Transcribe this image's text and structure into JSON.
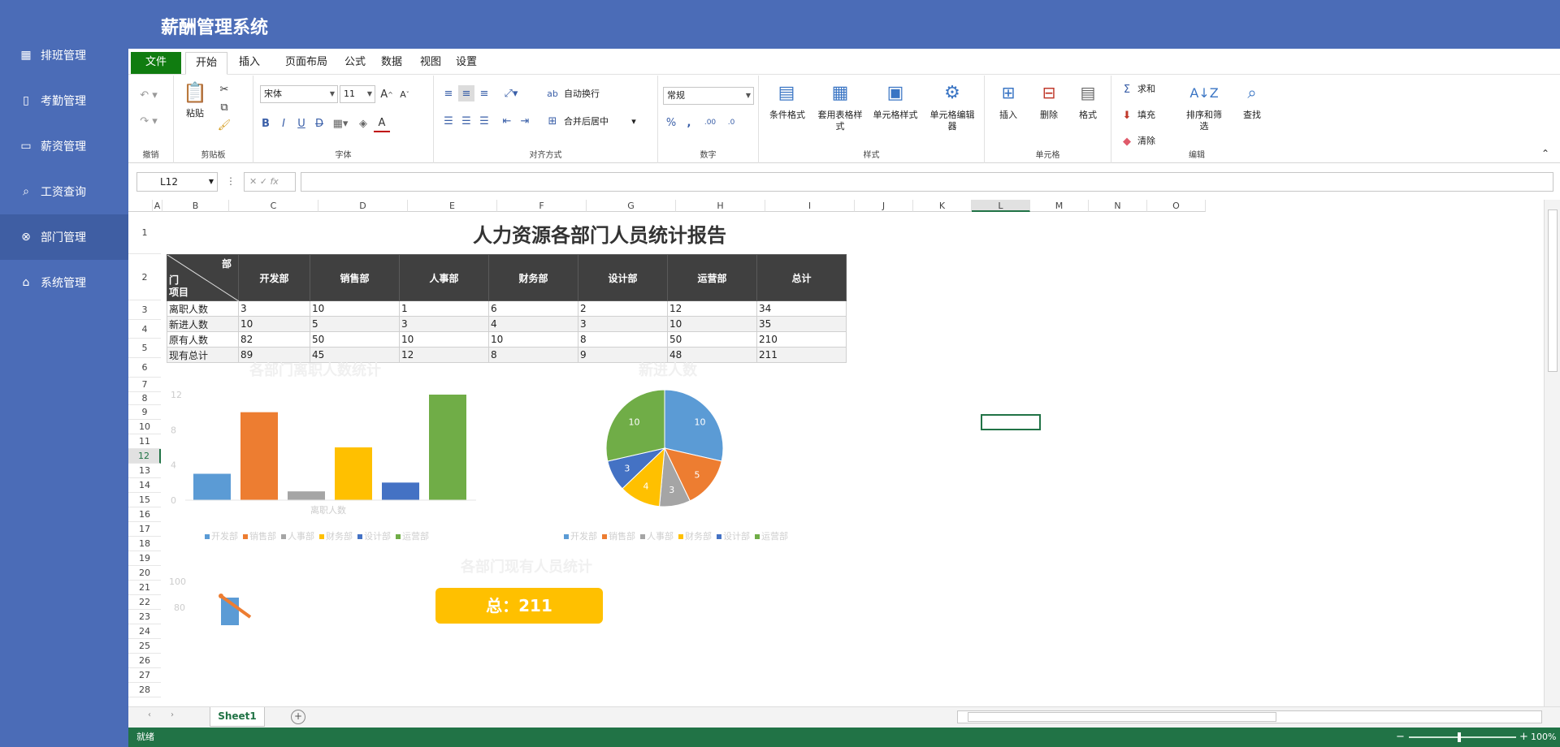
{
  "app": {
    "title": "薪酬管理系统"
  },
  "sidebar": {
    "items": [
      {
        "label": "排班管理",
        "icon": "grid-icon"
      },
      {
        "label": "考勤管理",
        "icon": "bookmark-icon"
      },
      {
        "label": "薪资管理",
        "icon": "monitor-icon"
      },
      {
        "label": "工资查询",
        "icon": "search-icon"
      },
      {
        "label": "部门管理",
        "icon": "link-icon",
        "active": true
      },
      {
        "label": "系统管理",
        "icon": "home-icon"
      }
    ]
  },
  "tabs": [
    "文件",
    "开始",
    "插入",
    "页面布局",
    "公式",
    "数据",
    "视图",
    "设置"
  ],
  "active_tab": "开始",
  "ribbon": {
    "groups": {
      "undo": "撤销",
      "clipboard": "剪贴板",
      "font": "字体",
      "align": "对齐方式",
      "number": "数字",
      "style": "样式",
      "cells": "单元格",
      "edit": "编辑"
    },
    "paste": "粘贴",
    "font_name": "宋体",
    "font_size": "11",
    "wrap": "自动换行",
    "merge": "合并后居中",
    "number_format": "常规",
    "cond_format": "条件格式",
    "table_style": "套用表格样式",
    "cell_style": "单元格样式",
    "cell_editor": "单元格编辑器",
    "insert": "插入",
    "delete": "删除",
    "format": "格式",
    "sum": "求和",
    "fill": "填充",
    "clear": "清除",
    "sort": "排序和筛选",
    "find": "查找"
  },
  "formula_bar": {
    "cell_ref": "L12",
    "fx": "fx"
  },
  "columns": [
    "A",
    "B",
    "C",
    "D",
    "E",
    "F",
    "G",
    "H",
    "I",
    "J",
    "K",
    "L",
    "M",
    "N",
    "O"
  ],
  "selected_col": "L",
  "selected_row": "12",
  "report": {
    "title": "人力资源各部门人员统计报告",
    "corner": {
      "dept": "部",
      "mid": "门",
      "item": "项目"
    },
    "headers": [
      "开发部",
      "销售部",
      "人事部",
      "财务部",
      "设计部",
      "运营部",
      "总计"
    ],
    "rows": [
      {
        "label": "离职人数",
        "values": [
          "3",
          "10",
          "1",
          "6",
          "2",
          "12",
          "34"
        ]
      },
      {
        "label": "新进人数",
        "values": [
          "10",
          "5",
          "3",
          "4",
          "3",
          "10",
          "35"
        ]
      },
      {
        "label": "原有人数",
        "values": [
          "82",
          "50",
          "10",
          "10",
          "8",
          "50",
          "210"
        ]
      },
      {
        "label": "现有总计",
        "values": [
          "89",
          "45",
          "12",
          "8",
          "9",
          "48",
          "211"
        ]
      }
    ]
  },
  "chart_data": [
    {
      "type": "bar",
      "title": "各部门离职人数统计",
      "categories": [
        "开发部",
        "销售部",
        "人事部",
        "财务部",
        "设计部",
        "运营部"
      ],
      "values": [
        3,
        10,
        1,
        6,
        2,
        12
      ],
      "xlabel": "离职人数",
      "ylim": [
        0,
        12
      ],
      "yticks": [
        "0",
        "4",
        "8",
        "12"
      ],
      "colors": [
        "#5b9bd5",
        "#ed7d31",
        "#a5a5a5",
        "#ffc000",
        "#4472c4",
        "#70ad47"
      ]
    },
    {
      "type": "pie",
      "title": "新进人数",
      "categories": [
        "开发部",
        "销售部",
        "人事部",
        "财务部",
        "设计部",
        "运营部"
      ],
      "values": [
        10,
        5,
        3,
        4,
        3,
        10
      ],
      "colors": [
        "#5b9bd5",
        "#ed7d31",
        "#a5a5a5",
        "#ffc000",
        "#4472c4",
        "#70ad47"
      ]
    },
    {
      "type": "line",
      "title": "各部门现有人员统计",
      "yticks": [
        "100",
        "80"
      ]
    }
  ],
  "total_box": "总：211",
  "sheet_tab": "Sheet1",
  "status": {
    "ready": "就绪",
    "zoom": "100%"
  }
}
